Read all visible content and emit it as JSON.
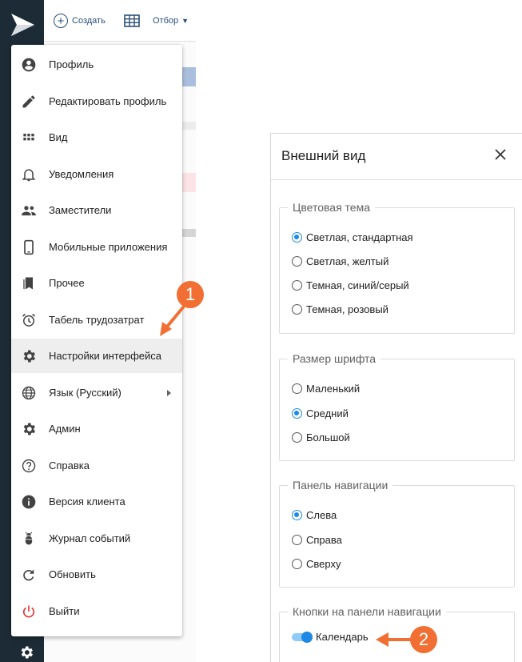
{
  "toolbar": {
    "create_label": "Создать",
    "filter_label": "Отбор"
  },
  "menu": {
    "items": [
      {
        "label": "Профиль",
        "icon": "account-circle-icon"
      },
      {
        "label": "Редактировать профиль",
        "icon": "pencil-icon"
      },
      {
        "label": "Вид",
        "icon": "grid-view-icon"
      },
      {
        "label": "Уведомления",
        "icon": "bell-icon"
      },
      {
        "label": "Заместители",
        "icon": "people-icon"
      },
      {
        "label": "Мобильные приложения",
        "icon": "smartphone-icon"
      },
      {
        "label": "Прочее",
        "icon": "bookmarks-icon"
      },
      {
        "label": "Табель трудозатрат",
        "icon": "alarm-clock-icon"
      },
      {
        "label": "Настройки интерфейса",
        "icon": "gear-icon",
        "active": true
      },
      {
        "label": "Язык (Русский)",
        "icon": "globe-icon",
        "submenu": true
      },
      {
        "label": "Админ",
        "icon": "gear-icon"
      },
      {
        "label": "Справка",
        "icon": "help-circle-icon"
      },
      {
        "label": "Версия клиента",
        "icon": "info-icon"
      },
      {
        "label": "Журнал событий",
        "icon": "bug-icon"
      },
      {
        "label": "Обновить",
        "icon": "refresh-icon"
      },
      {
        "label": "Выйти",
        "icon": "power-icon"
      }
    ]
  },
  "panel": {
    "title": "Внешний вид",
    "color_theme": {
      "legend": "Цветовая тема",
      "options": [
        "Светлая, стандартная",
        "Светлая, желтый",
        "Темная, синий/серый",
        "Темная, розовый"
      ],
      "selected": 0
    },
    "font_size": {
      "legend": "Размер шрифта",
      "options": [
        "Маленький",
        "Средний",
        "Большой"
      ],
      "selected": 1
    },
    "nav_panel": {
      "legend": "Панель навигации",
      "options": [
        "Слева",
        "Справа",
        "Сверху"
      ],
      "selected": 0
    },
    "nav_buttons": {
      "legend": "Кнопки на панели навигации",
      "calendar_label": "Календарь",
      "calendar_on": true
    }
  },
  "callouts": {
    "first": "1",
    "second": "2"
  },
  "colors": {
    "navbar": "#1c2b36",
    "accent": "#1e88e5",
    "callout": "#f26f33",
    "logout": "#e53935"
  }
}
